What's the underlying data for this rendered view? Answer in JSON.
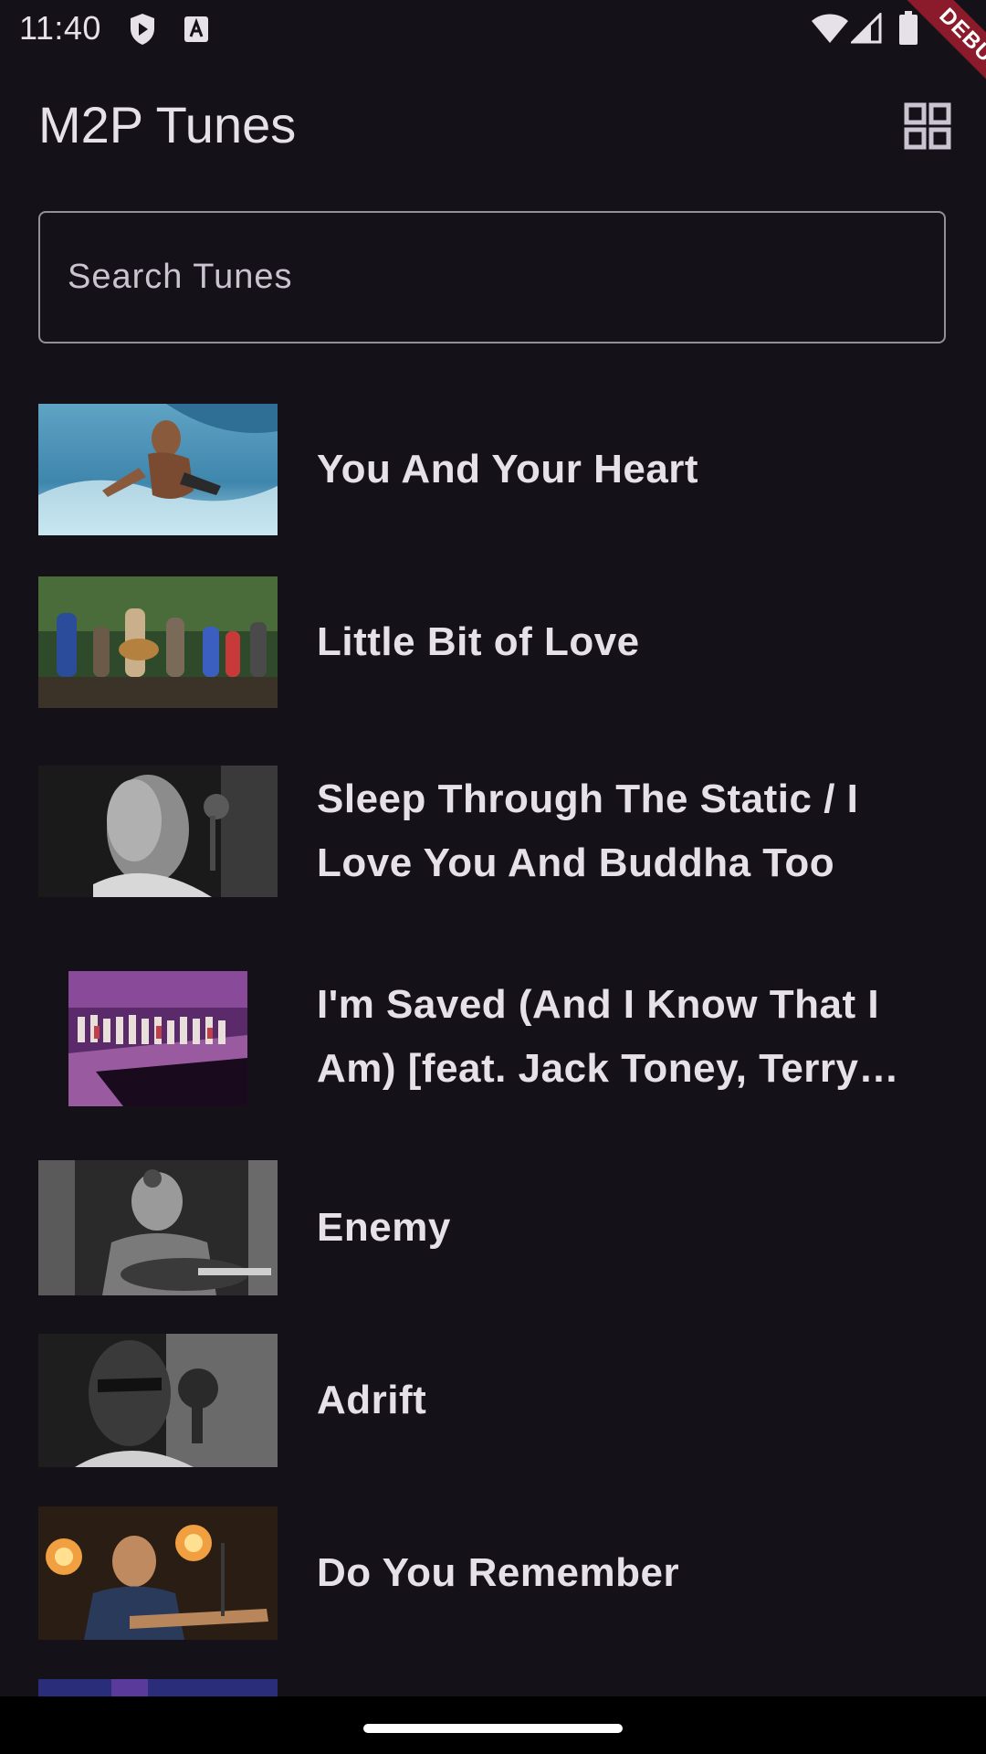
{
  "status_bar": {
    "time": "11:40",
    "icons": [
      "play-protect-icon",
      "a11y-icon",
      "wifi-icon",
      "signal-icon",
      "battery-icon"
    ]
  },
  "debug_banner": {
    "label": "DEBUG"
  },
  "app_bar": {
    "title": "M2P Tunes",
    "grid_icon": "grid-view-icon"
  },
  "search": {
    "placeholder": "Search Tunes",
    "value": ""
  },
  "tunes": [
    {
      "title_line1": "You And Your Heart",
      "title_line2": ""
    },
    {
      "title_line1": "Little Bit of Love",
      "title_line2": ""
    },
    {
      "title_line1": "Sleep Through The Static / I",
      "title_line2": "Love You And Buddha Too"
    },
    {
      "title_line1": "I'm Saved (And I Know That I",
      "title_line2": "Am) [feat. Jack Toney, Terry…"
    },
    {
      "title_line1": "Enemy",
      "title_line2": ""
    },
    {
      "title_line1": "Adrift",
      "title_line2": ""
    },
    {
      "title_line1": "Do You Remember",
      "title_line2": ""
    }
  ],
  "colors": {
    "background": "#141218",
    "text": "#e6e0e9",
    "outline": "#938f99",
    "debug_banner": "#8b1a2b"
  }
}
